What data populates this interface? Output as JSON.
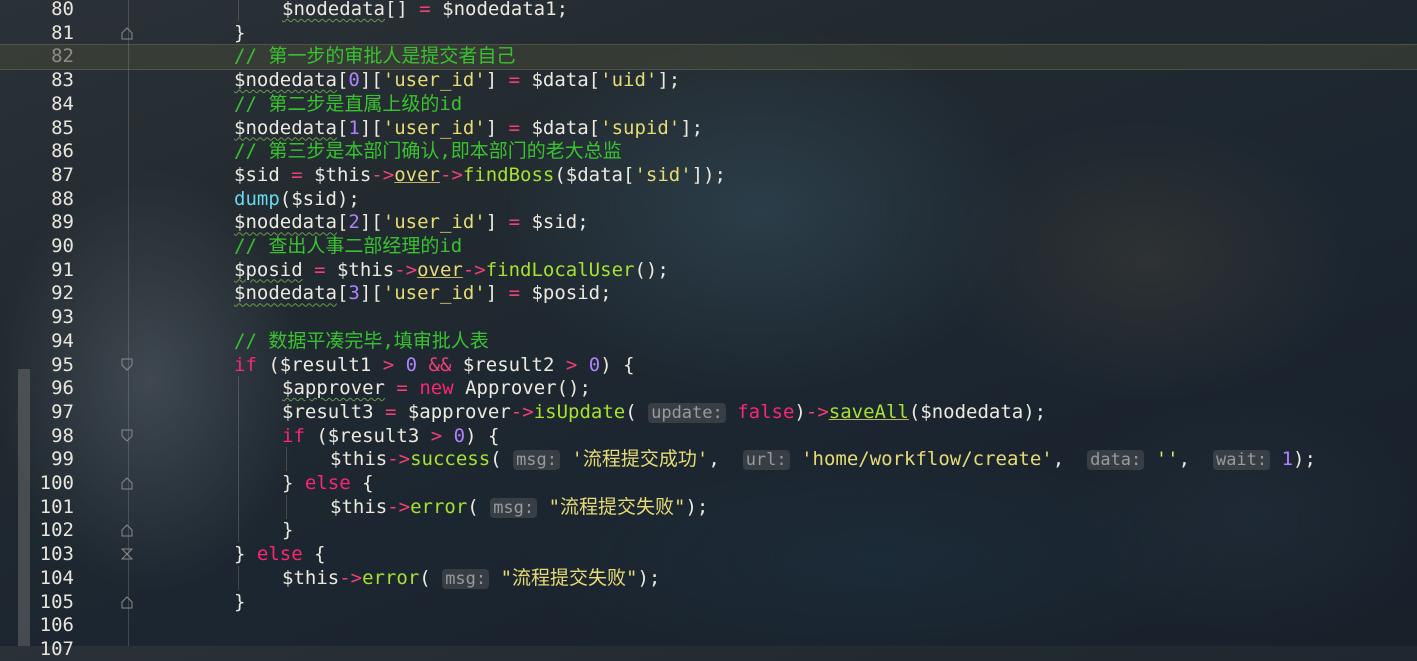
{
  "editor": {
    "current_line": 82,
    "lines": [
      {
        "n": 80,
        "indent": 2,
        "fold": "none",
        "tokens": [
          [
            "var",
            "$nodedata"
          ],
          [
            "plain",
            "[] "
          ],
          [
            "op",
            "="
          ],
          [
            "plain",
            " $nodedata1;"
          ]
        ]
      },
      {
        "n": 81,
        "indent": 1,
        "fold": "end",
        "tokens": [
          [
            "plain",
            "}"
          ]
        ]
      },
      {
        "n": 82,
        "indent": 1,
        "fold": "none",
        "tokens": [
          [
            "cmt",
            "// 第一步的审批人是提交者自己"
          ]
        ]
      },
      {
        "n": 83,
        "indent": 1,
        "fold": "none",
        "tokens": [
          [
            "var",
            "$nodedata"
          ],
          [
            "plain",
            "["
          ],
          [
            "num",
            "0"
          ],
          [
            "plain",
            "]["
          ],
          [
            "str",
            "'user_id'"
          ],
          [
            "plain",
            "] "
          ],
          [
            "op",
            "="
          ],
          [
            "plain",
            " $data["
          ],
          [
            "str",
            "'uid'"
          ],
          [
            "plain",
            "];"
          ]
        ]
      },
      {
        "n": 84,
        "indent": 1,
        "fold": "none",
        "tokens": [
          [
            "cmt",
            "// 第二步是直属上级的id"
          ]
        ]
      },
      {
        "n": 85,
        "indent": 1,
        "fold": "none",
        "tokens": [
          [
            "var",
            "$nodedata"
          ],
          [
            "plain",
            "["
          ],
          [
            "num",
            "1"
          ],
          [
            "plain",
            "]["
          ],
          [
            "str",
            "'user_id'"
          ],
          [
            "plain",
            "] "
          ],
          [
            "op",
            "="
          ],
          [
            "plain",
            " $data["
          ],
          [
            "str",
            "'supid'"
          ],
          [
            "plain",
            "];"
          ]
        ]
      },
      {
        "n": 86,
        "indent": 1,
        "fold": "none",
        "tokens": [
          [
            "cmt",
            "// 第三步是本部门确认,即本部门的老大总监"
          ]
        ]
      },
      {
        "n": 87,
        "indent": 1,
        "fold": "none",
        "tokens": [
          [
            "plain",
            "$sid "
          ],
          [
            "op",
            "="
          ],
          [
            "plain",
            " $this"
          ],
          [
            "op",
            "->"
          ],
          [
            "under",
            "over"
          ],
          [
            "op",
            "->"
          ],
          [
            "fn",
            "findBoss"
          ],
          [
            "plain",
            "($data["
          ],
          [
            "str",
            "'sid'"
          ],
          [
            "plain",
            "]);"
          ]
        ]
      },
      {
        "n": 88,
        "indent": 1,
        "fold": "none",
        "tokens": [
          [
            "call",
            "dump"
          ],
          [
            "plain",
            "($sid);"
          ]
        ]
      },
      {
        "n": 89,
        "indent": 1,
        "fold": "none",
        "tokens": [
          [
            "var",
            "$nodedata"
          ],
          [
            "plain",
            "["
          ],
          [
            "num",
            "2"
          ],
          [
            "plain",
            "]["
          ],
          [
            "str",
            "'user_id'"
          ],
          [
            "plain",
            "] "
          ],
          [
            "op",
            "="
          ],
          [
            "plain",
            " $sid;"
          ]
        ]
      },
      {
        "n": 90,
        "indent": 1,
        "fold": "none",
        "tokens": [
          [
            "cmt",
            "// 查出人事二部经理的id"
          ]
        ]
      },
      {
        "n": 91,
        "indent": 1,
        "fold": "none",
        "tokens": [
          [
            "var",
            "$posid"
          ],
          [
            "plain",
            " "
          ],
          [
            "op",
            "="
          ],
          [
            "plain",
            " $this"
          ],
          [
            "op",
            "->"
          ],
          [
            "under",
            "over"
          ],
          [
            "op",
            "->"
          ],
          [
            "fn",
            "findLocalUser"
          ],
          [
            "plain",
            "();"
          ]
        ]
      },
      {
        "n": 92,
        "indent": 1,
        "fold": "none",
        "tokens": [
          [
            "var",
            "$nodedata"
          ],
          [
            "plain",
            "["
          ],
          [
            "num",
            "3"
          ],
          [
            "plain",
            "]["
          ],
          [
            "str",
            "'user_id'"
          ],
          [
            "plain",
            "] "
          ],
          [
            "op",
            "="
          ],
          [
            "plain",
            " $posid;"
          ]
        ]
      },
      {
        "n": 93,
        "indent": 1,
        "fold": "none",
        "tokens": []
      },
      {
        "n": 94,
        "indent": 1,
        "fold": "none",
        "tokens": [
          [
            "cmt",
            "// 数据平凑完毕,填审批人表"
          ]
        ]
      },
      {
        "n": 95,
        "indent": 1,
        "fold": "start",
        "tokens": [
          [
            "kw",
            "if"
          ],
          [
            "plain",
            " ($result1 "
          ],
          [
            "op",
            ">"
          ],
          [
            "plain",
            " "
          ],
          [
            "num",
            "0"
          ],
          [
            "plain",
            " "
          ],
          [
            "op",
            "&&"
          ],
          [
            "plain",
            " $result2 "
          ],
          [
            "op",
            ">"
          ],
          [
            "plain",
            " "
          ],
          [
            "num",
            "0"
          ],
          [
            "plain",
            ") {"
          ]
        ]
      },
      {
        "n": 96,
        "indent": 2,
        "fold": "none",
        "tokens": [
          [
            "var",
            "$approver"
          ],
          [
            "plain",
            " "
          ],
          [
            "op",
            "="
          ],
          [
            "plain",
            " "
          ],
          [
            "kw",
            "new"
          ],
          [
            "plain",
            " Approver();"
          ]
        ]
      },
      {
        "n": 97,
        "indent": 2,
        "fold": "none",
        "tokens": [
          [
            "plain",
            "$result3 "
          ],
          [
            "op",
            "="
          ],
          [
            "plain",
            " $approver"
          ],
          [
            "op",
            "->"
          ],
          [
            "fn",
            "isUpdate"
          ],
          [
            "plain",
            "( "
          ],
          [
            "hint",
            "update:"
          ],
          [
            "plain",
            " "
          ],
          [
            "kw",
            "false"
          ],
          [
            "plain",
            ")"
          ],
          [
            "op",
            "->"
          ],
          [
            "fnunder",
            "saveAll"
          ],
          [
            "plain",
            "($nodedata);"
          ]
        ]
      },
      {
        "n": 98,
        "indent": 2,
        "fold": "start",
        "tokens": [
          [
            "kw",
            "if"
          ],
          [
            "plain",
            " ($result3 "
          ],
          [
            "op",
            ">"
          ],
          [
            "plain",
            " "
          ],
          [
            "num",
            "0"
          ],
          [
            "plain",
            ") {"
          ]
        ]
      },
      {
        "n": 99,
        "indent": 3,
        "fold": "none",
        "tokens": [
          [
            "plain",
            "$this"
          ],
          [
            "op",
            "->"
          ],
          [
            "fn",
            "success"
          ],
          [
            "plain",
            "( "
          ],
          [
            "hint",
            "msg:"
          ],
          [
            "plain",
            " "
          ],
          [
            "str",
            "'流程提交成功'"
          ],
          [
            "plain",
            ",  "
          ],
          [
            "hint",
            "url:"
          ],
          [
            "plain",
            " "
          ],
          [
            "str",
            "'home/workflow/create'"
          ],
          [
            "plain",
            ",  "
          ],
          [
            "hint",
            "data:"
          ],
          [
            "plain",
            " "
          ],
          [
            "str",
            "''"
          ],
          [
            "plain",
            ",  "
          ],
          [
            "hint",
            "wait:"
          ],
          [
            "plain",
            " "
          ],
          [
            "num",
            "1"
          ],
          [
            "plain",
            ");"
          ]
        ]
      },
      {
        "n": 100,
        "indent": 2,
        "fold": "end",
        "tokens": [
          [
            "plain",
            "} "
          ],
          [
            "kw",
            "else"
          ],
          [
            "plain",
            " {"
          ]
        ]
      },
      {
        "n": 101,
        "indent": 3,
        "fold": "none",
        "tokens": [
          [
            "plain",
            "$this"
          ],
          [
            "op",
            "->"
          ],
          [
            "fn",
            "error"
          ],
          [
            "plain",
            "( "
          ],
          [
            "hint",
            "msg:"
          ],
          [
            "plain",
            " "
          ],
          [
            "str",
            "\"流程提交失败\""
          ],
          [
            "plain",
            ");"
          ]
        ]
      },
      {
        "n": 102,
        "indent": 2,
        "fold": "end",
        "tokens": [
          [
            "plain",
            "}"
          ]
        ]
      },
      {
        "n": 103,
        "indent": 1,
        "fold": "both",
        "tokens": [
          [
            "plain",
            "} "
          ],
          [
            "kw",
            "else"
          ],
          [
            "plain",
            " {"
          ]
        ]
      },
      {
        "n": 104,
        "indent": 2,
        "fold": "none",
        "tokens": [
          [
            "plain",
            "$this"
          ],
          [
            "op",
            "->"
          ],
          [
            "fn",
            "error"
          ],
          [
            "plain",
            "( "
          ],
          [
            "hint",
            "msg:"
          ],
          [
            "plain",
            " "
          ],
          [
            "str",
            "\"流程提交失败\""
          ],
          [
            "plain",
            ");"
          ]
        ]
      },
      {
        "n": 105,
        "indent": 1,
        "fold": "end",
        "tokens": [
          [
            "plain",
            "}"
          ]
        ]
      },
      {
        "n": 106,
        "indent": 1,
        "fold": "none",
        "tokens": []
      },
      {
        "n": 107,
        "indent": 1,
        "fold": "none",
        "tokens": []
      }
    ]
  },
  "colors": {
    "comment": "#39c22f",
    "string": "#e6db74",
    "number": "#ae81ff",
    "operator": "#f33f77",
    "keyword": "#f92672",
    "function": "#a6e22e",
    "builtin": "#66d9ef"
  }
}
